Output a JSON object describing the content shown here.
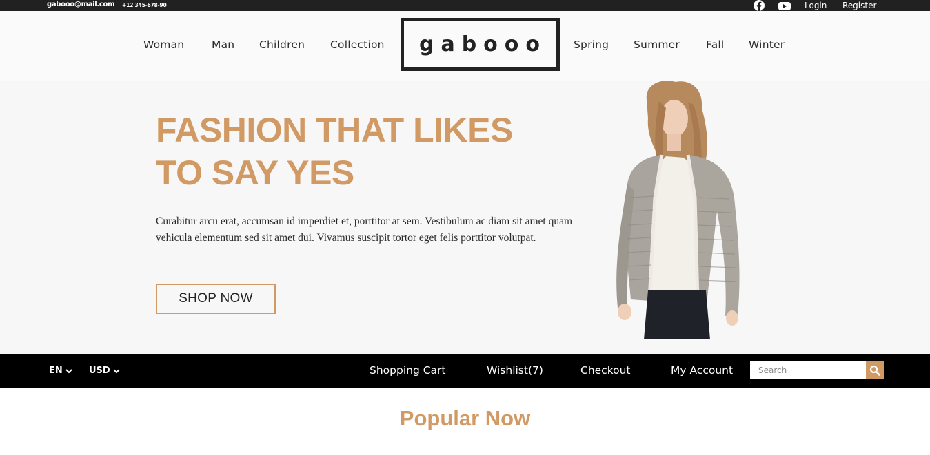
{
  "topbar": {
    "email": "gabooo@mail.com",
    "phone": "+12 345-678-90",
    "icons": [
      "facebook-icon",
      "youtube-icon"
    ],
    "login": "Login",
    "register": "Register"
  },
  "nav": {
    "left": [
      "Woman",
      "Man",
      "Children",
      "Collection"
    ],
    "logo": "gabooo",
    "right": [
      "Spring",
      "Summer",
      "Fall",
      "Winter"
    ]
  },
  "hero": {
    "title_line1": "FASHION THAT LIKES",
    "title_line2": "TO SAY YES",
    "text": "Curabitur arcu erat, accumsan id imperdiet et, porttitor at sem. Vestibulum ac diam sit amet quam vehicula elementum sed sit amet dui. Vivamus suscipit tortor eget felis porttitor volutpat.",
    "button": "SHOP NOW"
  },
  "bar": {
    "language": "EN",
    "currency": "USD",
    "links": [
      "Shopping Cart",
      "Wishlist(7)",
      "Checkout",
      "My Account"
    ],
    "search_placeholder": "Search",
    "search_icon": "search-icon"
  },
  "section": {
    "heading": "Popular Now"
  },
  "colors": {
    "accent": "#d19a64",
    "topbar": "#212121",
    "bar": "#000000",
    "hero_bg": "#f7f7f7"
  }
}
